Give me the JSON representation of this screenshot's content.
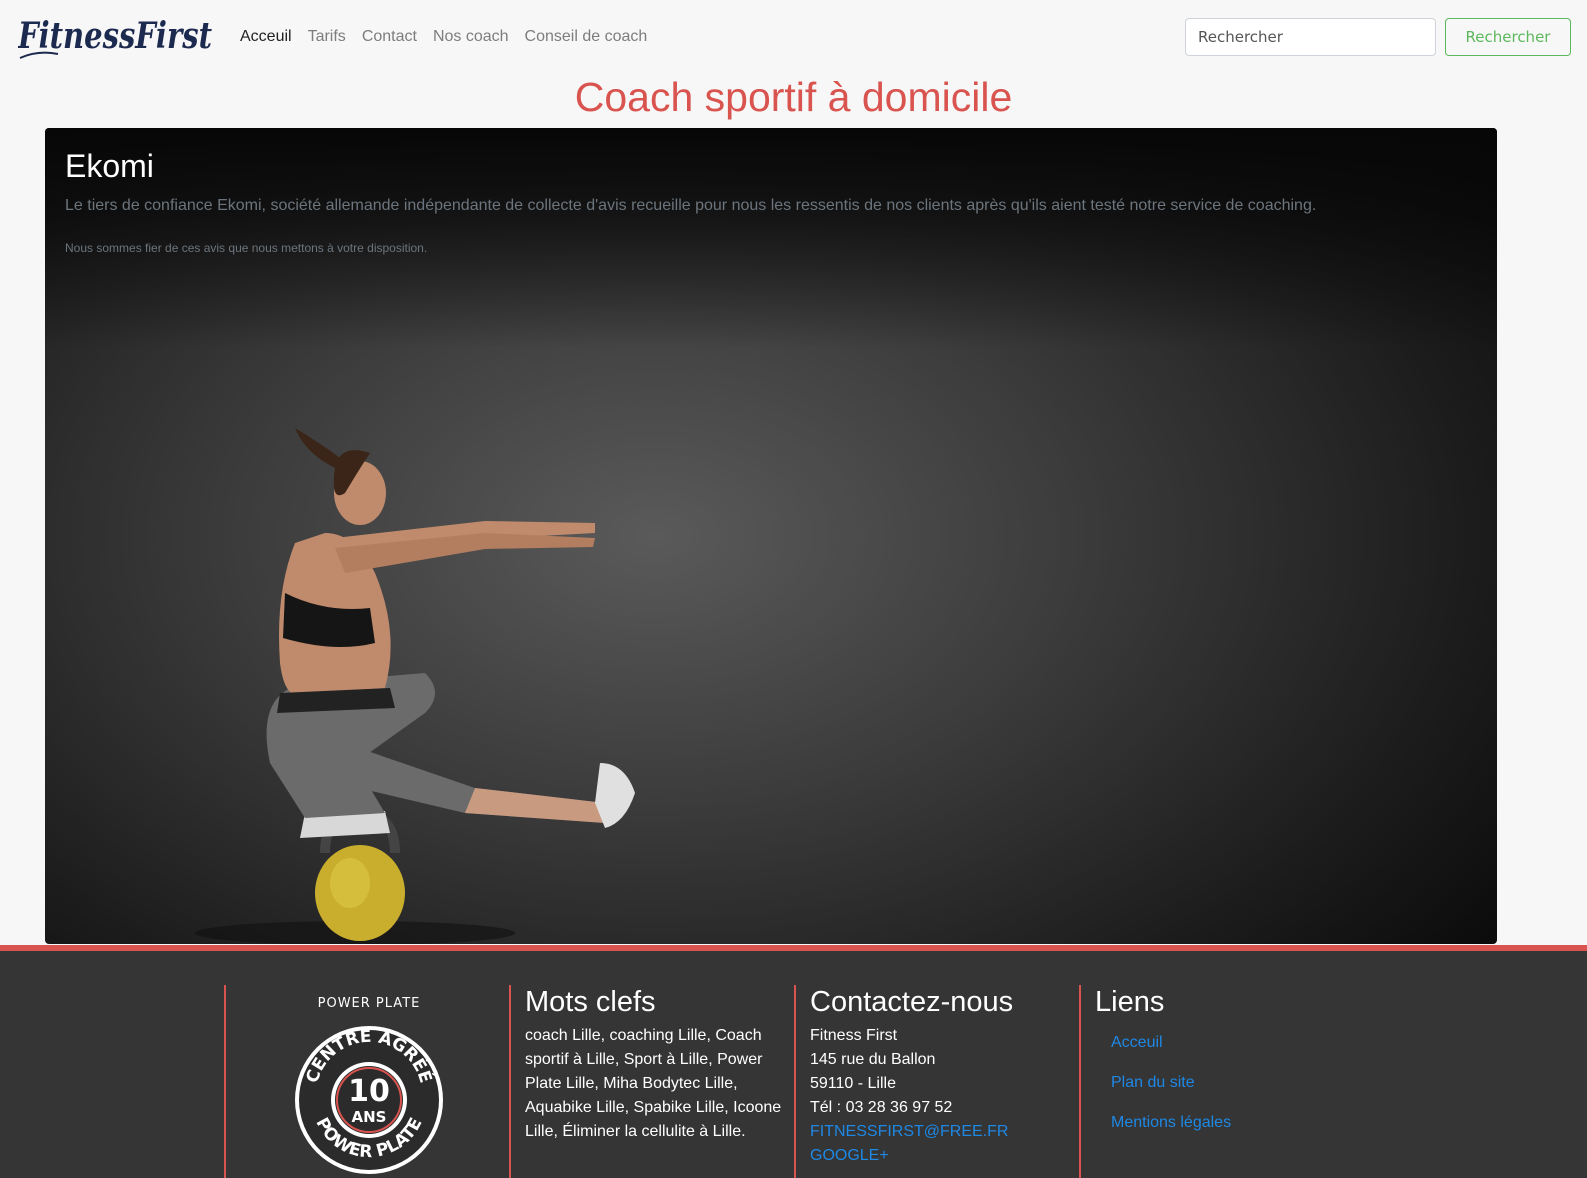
{
  "header": {
    "logo_text": "FitnessFirst",
    "nav": [
      {
        "label": "Acceuil",
        "active": true
      },
      {
        "label": "Tarifs",
        "active": false
      },
      {
        "label": "Contact",
        "active": false
      },
      {
        "label": "Nos coach",
        "active": false
      },
      {
        "label": "Conseil de coach",
        "active": false
      }
    ],
    "search": {
      "placeholder": "Rechercher",
      "button_label": "Rechercher"
    }
  },
  "main": {
    "title": "Coach sportif à domicile",
    "hero": {
      "title": "Ekomi",
      "lead": "Le tiers de confiance Ekomi, société allemande indépendante de collecte d'avis recueille pour nous les ressentis de nos clients après qu'ils aient testé notre service de coaching.",
      "note": "Nous sommes fier de ces avis que nous mettons à votre disposition."
    }
  },
  "footer": {
    "badge": {
      "brand_top": "POWER PLATE",
      "ring_top": "CENTRE AGRÉÉ",
      "center_number": "10",
      "center_word": "ANS",
      "ring_bottom": "POWER PLATE"
    },
    "keywords": {
      "title": "Mots clefs",
      "text": "coach Lille, coaching Lille, Coach sportif à Lille, Sport à Lille, Power Plate Lille, Miha Bodytec Lille, Aquabike Lille, Spabike Lille, Icoone Lille, Éliminer la cellulite à Lille."
    },
    "contact": {
      "title": "Contactez-nous",
      "lines": [
        "Fitness First",
        "145 rue du Ballon",
        "59110 - Lille",
        "Tél : 03 28 36 97 52"
      ],
      "email": "FITNESSFIRST@FREE.FR",
      "social": "GOOGLE+"
    },
    "links": {
      "title": "Liens",
      "items": [
        "Acceuil",
        "Plan du site",
        "Mentions légales"
      ]
    }
  },
  "colors": {
    "accent": "#d9534f",
    "success": "#5cb85c",
    "link": "#1e88e5",
    "footer_bg": "#353535",
    "page_bg": "#f7f7f7"
  }
}
